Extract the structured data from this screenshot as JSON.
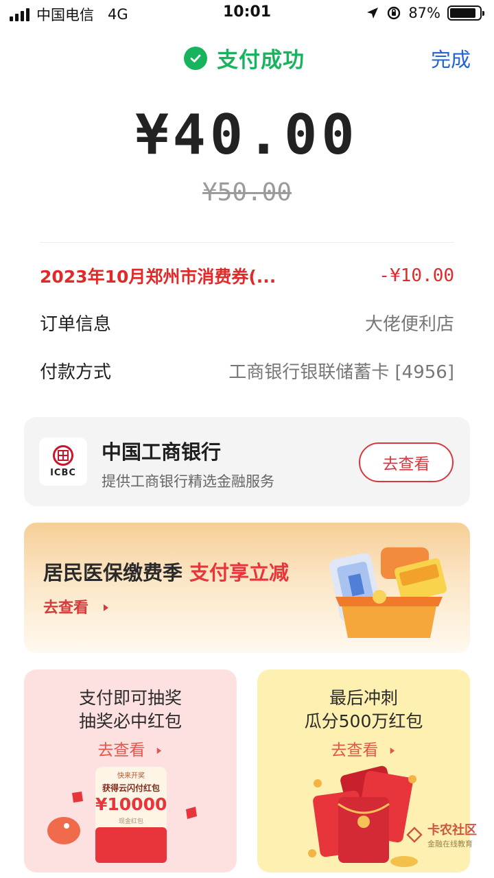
{
  "status_bar": {
    "carrier": "中国电信",
    "network": "4G",
    "time": "10:01",
    "battery": "87%",
    "battery_level": 0.87
  },
  "header": {
    "title": "支付成功",
    "done_label": "完成"
  },
  "payment": {
    "amount": "¥40.00",
    "original_amount": "¥50.00"
  },
  "details": {
    "coupon_label": "2023年10月郑州市消费券(...",
    "coupon_value": "-¥10.00",
    "order_label": "订单信息",
    "order_value": "大佬便利店",
    "method_label": "付款方式",
    "method_value": "工商银行银联储蓄卡 [4956]"
  },
  "bank": {
    "logo_text": "ICBC",
    "name": "中国工商银行",
    "desc": "提供工商银行精选金融服务",
    "button": "去查看"
  },
  "promo": {
    "title": "居民医保缴费季",
    "highlight": "支付享立减",
    "link": "去查看"
  },
  "cards": [
    {
      "line1": "支付即可抽奖",
      "line2": "抽奖必中红包",
      "link": "去查看",
      "art_top": "快来开奖",
      "art_caption": "获得云闪付红包",
      "art_amount": "¥10000",
      "art_sub": "现金红包"
    },
    {
      "line1": "最后冲刺",
      "line2": "瓜分500万红包",
      "link": "去查看"
    }
  ],
  "watermark": {
    "name": "卡农社区",
    "sub": "金融在线教育"
  },
  "colors": {
    "success_green": "#17b35d",
    "link_blue": "#1f63d6",
    "accent_red": "#e02a2a"
  }
}
